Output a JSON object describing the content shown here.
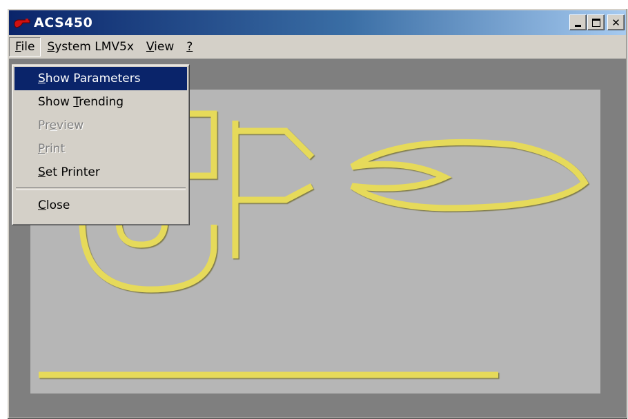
{
  "window": {
    "title": "ACS450",
    "app_icon": "red-burner-icon"
  },
  "menubar": {
    "items": [
      {
        "accel": "F",
        "rest": "ile"
      },
      {
        "accel": "S",
        "rest": "ystem LMV5x"
      },
      {
        "accel": "V",
        "rest": "iew"
      },
      {
        "accel": "?",
        "rest": ""
      }
    ]
  },
  "file_menu": {
    "show_parameters": {
      "accel": "S",
      "rest": "how Parameters"
    },
    "show_trending": {
      "pre": "Show ",
      "accel": "T",
      "rest": "rending"
    },
    "preview": {
      "pre": "Pr",
      "accel": "e",
      "rest": "view"
    },
    "print": {
      "accel": "P",
      "rest": "rint"
    },
    "set_printer": {
      "accel": "S",
      "rest": "et Printer"
    },
    "close": {
      "accel": "C",
      "rest": "lose"
    }
  },
  "colors": {
    "title_gradient_start": "#0a246a",
    "title_gradient_end": "#a6caf0",
    "selection": "#0a246a",
    "logo_yellow": "#e6da5a",
    "panel": "#b6b6b6",
    "client_background": "#7f7f7f"
  },
  "icons": [
    "minimize-icon",
    "maximize-icon",
    "close-icon",
    "burner-logo"
  ]
}
